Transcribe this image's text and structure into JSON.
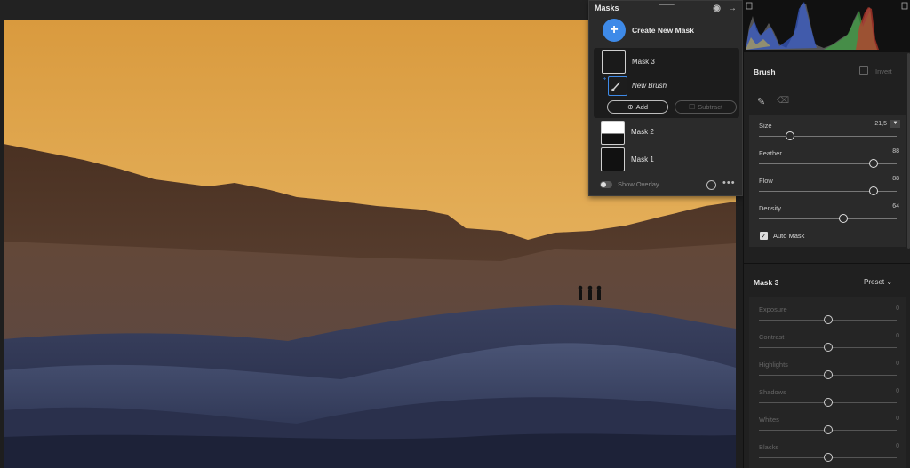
{
  "masks_panel": {
    "title": "Masks",
    "create_new_mask": "Create New Mask",
    "mask3_label": "Mask 3",
    "new_brush_label": "New Brush",
    "add_label": "Add",
    "subtract_label": "Subtract",
    "mask2_label": "Mask 2",
    "mask1_label": "Mask 1",
    "show_overlay": "Show Overlay"
  },
  "brush": {
    "title": "Brush",
    "invert": "Invert",
    "size_label": "Size",
    "size_value": "21,5",
    "feather_label": "Feather",
    "feather_value": "88",
    "flow_label": "Flow",
    "flow_value": "88",
    "density_label": "Density",
    "density_value": "64",
    "auto_mask": "Auto Mask"
  },
  "mask3_adjust": {
    "title": "Mask 3",
    "preset": "Preset",
    "sliders": [
      {
        "label": "Exposure",
        "value": "0"
      },
      {
        "label": "Contrast",
        "value": "0"
      },
      {
        "label": "Highlights",
        "value": "0"
      },
      {
        "label": "Shadows",
        "value": "0"
      },
      {
        "label": "Whites",
        "value": "0"
      },
      {
        "label": "Blacks",
        "value": "0"
      }
    ]
  },
  "colors": {
    "accent": "#3e8ae8",
    "sky_top": "#e0a24a",
    "dunes": "#2c3350"
  }
}
